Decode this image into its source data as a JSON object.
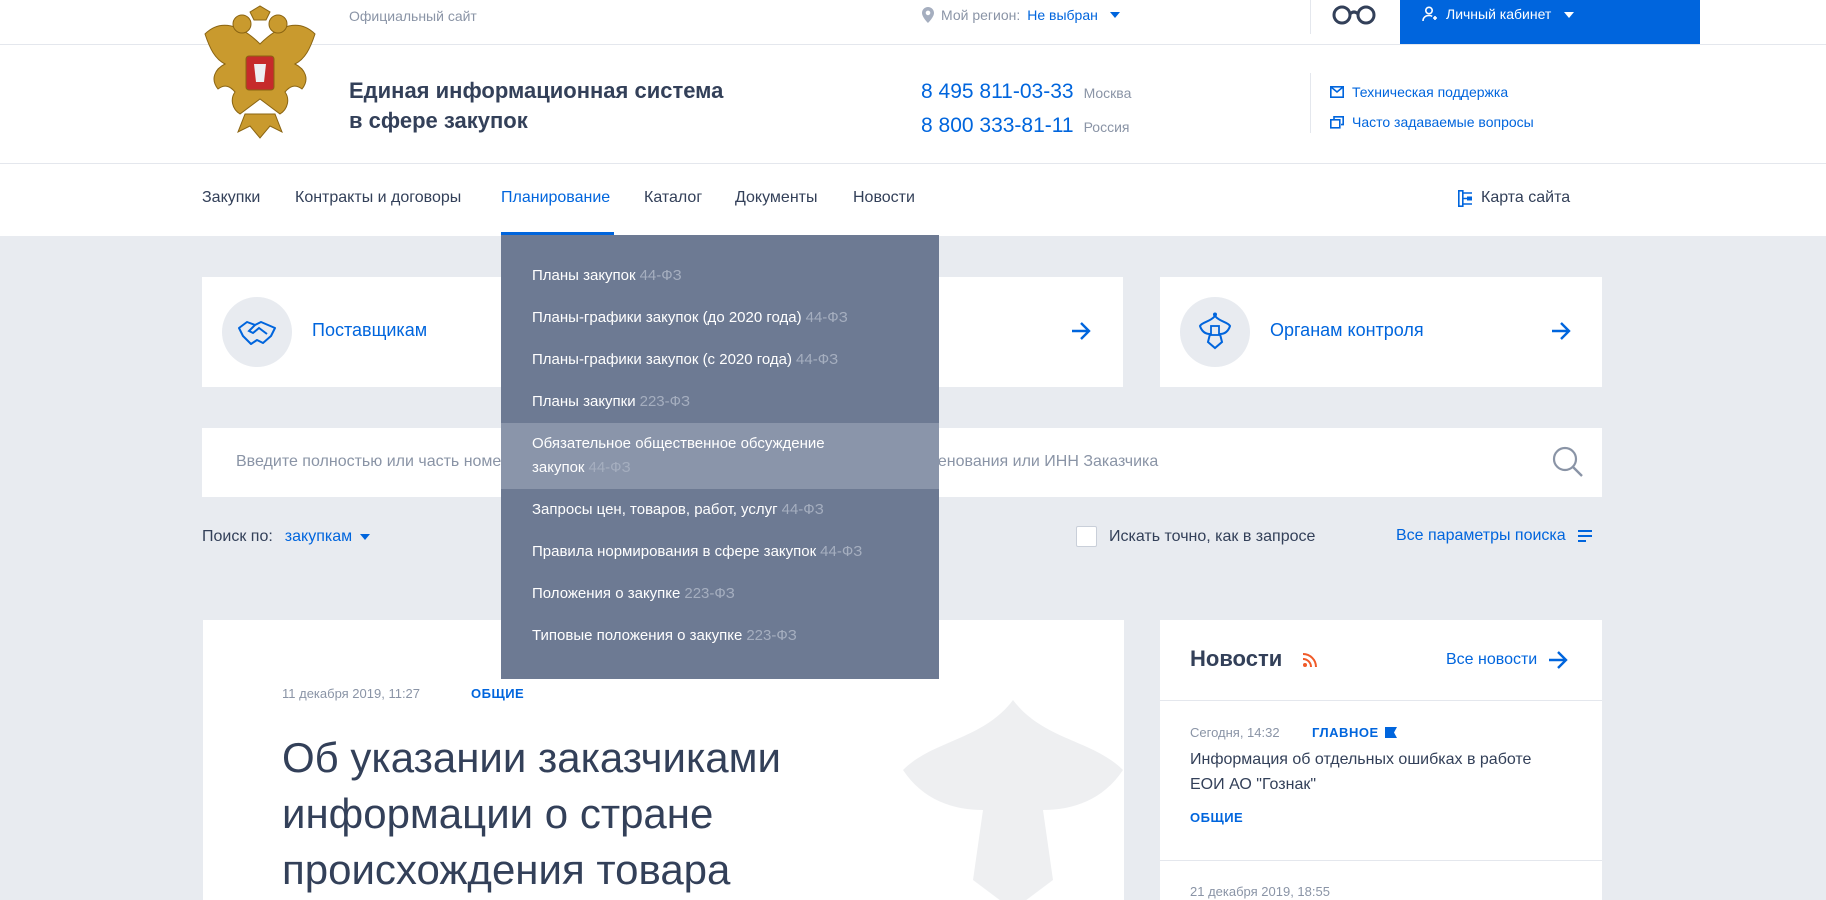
{
  "header": {
    "official": "Официальный сайт",
    "region_label": "Мой регион:",
    "region_value": "Не выбран",
    "cabinet": "Личный кабинет",
    "site_title_line1": "Единая информационная система",
    "site_title_line2": "в сфере закупок",
    "phone1": "8 495 811-03-33",
    "phone1_city": "Москва",
    "phone2": "8 800 333-81-11",
    "phone2_city": "Россия",
    "support": "Техническая поддержка",
    "faq": "Часто задаваемые вопросы"
  },
  "nav": {
    "items": [
      "Закупки",
      "Контракты и договоры",
      "Планирование",
      "Каталог",
      "Документы",
      "Новости"
    ],
    "active": "Планирование",
    "sitemap": "Карта сайта"
  },
  "dropdown": {
    "items": [
      {
        "label": "Планы закупок",
        "law": "44-ФЗ"
      },
      {
        "label": "Планы-графики закупок (до 2020 года)",
        "law": "44-ФЗ"
      },
      {
        "label": "Планы-графики закупок (с 2020 года)",
        "law": "44-ФЗ"
      },
      {
        "label": "Планы закупки",
        "law": "223-ФЗ"
      },
      {
        "label": "Обязательное общественное обсуждение закупок",
        "law": "44-ФЗ"
      },
      {
        "label": "Запросы цен, товаров, работ, услуг",
        "law": "44-ФЗ"
      },
      {
        "label": "Правила нормирования в сфере закупок",
        "law": "44-ФЗ"
      },
      {
        "label": "Положения о закупке",
        "law": "223-ФЗ"
      },
      {
        "label": "Типовые положения о закупке",
        "law": "223-ФЗ"
      }
    ]
  },
  "cards": {
    "suppliers": "Поставщикам",
    "control": "Органам контроля"
  },
  "search": {
    "placeholder": "Введите полностью или часть номера закупки, идентификационного кода закупки (ИКЗ), наименования или ИНН Заказчика",
    "by_label": "Поиск по:",
    "by_value": "закупкам",
    "exact": "Искать точно, как в запросе",
    "all_params": "Все параметры поиска"
  },
  "article": {
    "date": "11 декабря 2019, 11:27",
    "tag": "ОБЩИЕ",
    "title": "Об указании заказчиками информации о стране происхождения товара"
  },
  "news": {
    "title": "Новости",
    "all": "Все новости",
    "item1_date": "Сегодня, 14:32",
    "item1_tag": "ГЛАВНОЕ",
    "item1_text": "Информация об отдельных ошибках в работе ЕОИ АО \"Гознак\"",
    "item1_category": "ОБЩИЕ",
    "item2_date": "21 декабря 2019, 18:55"
  },
  "colors": {
    "accent": "#0065dd",
    "dropdown_bg": "#6d7a93",
    "page_bg": "#e8ebf0"
  }
}
